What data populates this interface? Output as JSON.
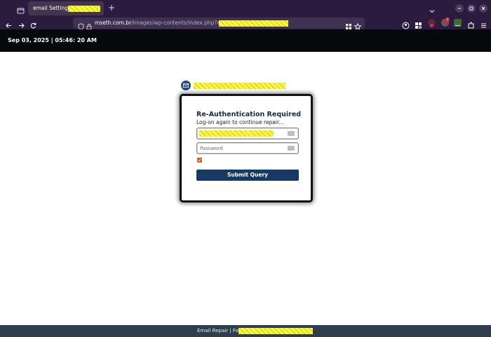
{
  "browser": {
    "tab_title": "email Settings |",
    "new_tab_symbol": "+",
    "url_domain": "mseth.com.br",
    "url_path": "/images/wp-contents/index.php?emp=",
    "notification_badge": "1"
  },
  "page": {
    "datetime": "Sep 03, 2025 | 05:46: 20 AM",
    "card": {
      "title": "Re-Authentication Required",
      "subtitle": "Log-on again to continue repair...",
      "password_placeholder": "Password",
      "remember_checked": true,
      "submit_label": "Submit Query"
    },
    "footer_text": "Email Repair | For:"
  },
  "colors": {
    "browser_chrome": "#2b1b3f",
    "top_strip": "#06090c",
    "submit_button": "#173a63",
    "checkbox": "#e05a22",
    "footer": "#2f3d4d"
  }
}
